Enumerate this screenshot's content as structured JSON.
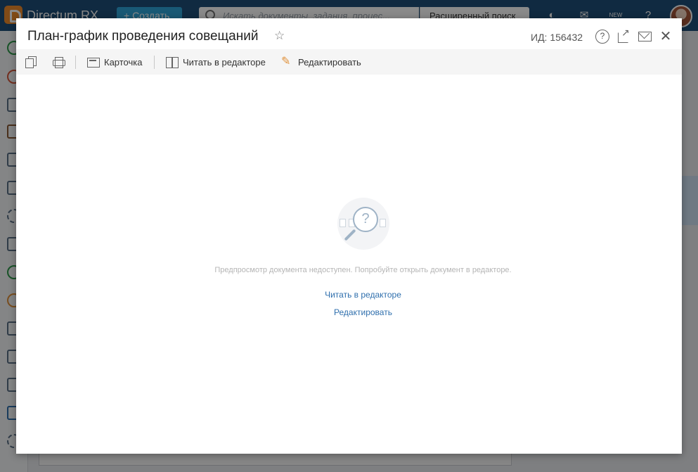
{
  "background_app": {
    "brand": "Directum RX",
    "create_button": "+ Создать",
    "search_placeholder": "Искать документы, задания, процес...",
    "advanced_search": "Расширенный поиск",
    "new_badge": "NEW"
  },
  "dialog": {
    "title": "План-график проведения совещаний",
    "id_label": "ИД: 156432",
    "icons": [
      "star-icon",
      "help-icon",
      "open-in-new-window-icon",
      "mail-icon",
      "close-icon"
    ]
  },
  "toolbar": {
    "card_label": "Карточка",
    "read_in_editor_label": "Читать в редакторе",
    "edit_label": "Редактировать"
  },
  "preview": {
    "message": "Предпросмотр документа недоступен. Попробуйте открыть документ в редакторе.",
    "read_link": "Читать в редакторе",
    "edit_link": "Редактировать"
  },
  "colors": {
    "header_bg": "#1f4e79",
    "accent_create": "#2fa4d8",
    "link": "#2f6fad",
    "edit_pencil": "#e0913a"
  }
}
